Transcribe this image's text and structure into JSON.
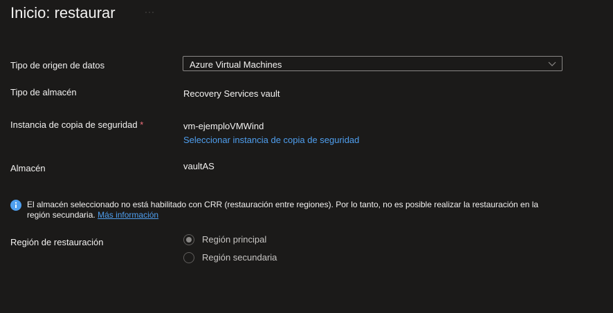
{
  "header": {
    "title": "Inicio: restaurar",
    "more_label": "···"
  },
  "form": {
    "datasource_type": {
      "label": "Tipo de origen de datos",
      "value": "Azure Virtual Machines"
    },
    "vault_type": {
      "label": "Tipo de almacén",
      "value": "Recovery Services vault"
    },
    "backup_instance": {
      "label": "Instancia de copia de seguridad",
      "required_mark": "*",
      "value": "vm-ejemploVMWind",
      "select_link": "Seleccionar instancia de copia de seguridad"
    },
    "vault": {
      "label": "Almacén",
      "value": "vaultAS"
    },
    "info": {
      "message": "El almacén seleccionado no está habilitado con CRR (restauración entre regiones). Por lo tanto, no es posible realizar la restauración en la región secundaria. ",
      "link": "Más información"
    },
    "restore_region": {
      "label": "Región de restauración",
      "options": [
        {
          "label": "Región principal",
          "checked": true,
          "disabled": true
        },
        {
          "label": "Región secundaria",
          "checked": false,
          "disabled": true
        }
      ]
    }
  },
  "colors": {
    "background": "#1b1a19",
    "link": "#4f9fef",
    "info": "#4f9fef",
    "required": "#f1707b"
  }
}
